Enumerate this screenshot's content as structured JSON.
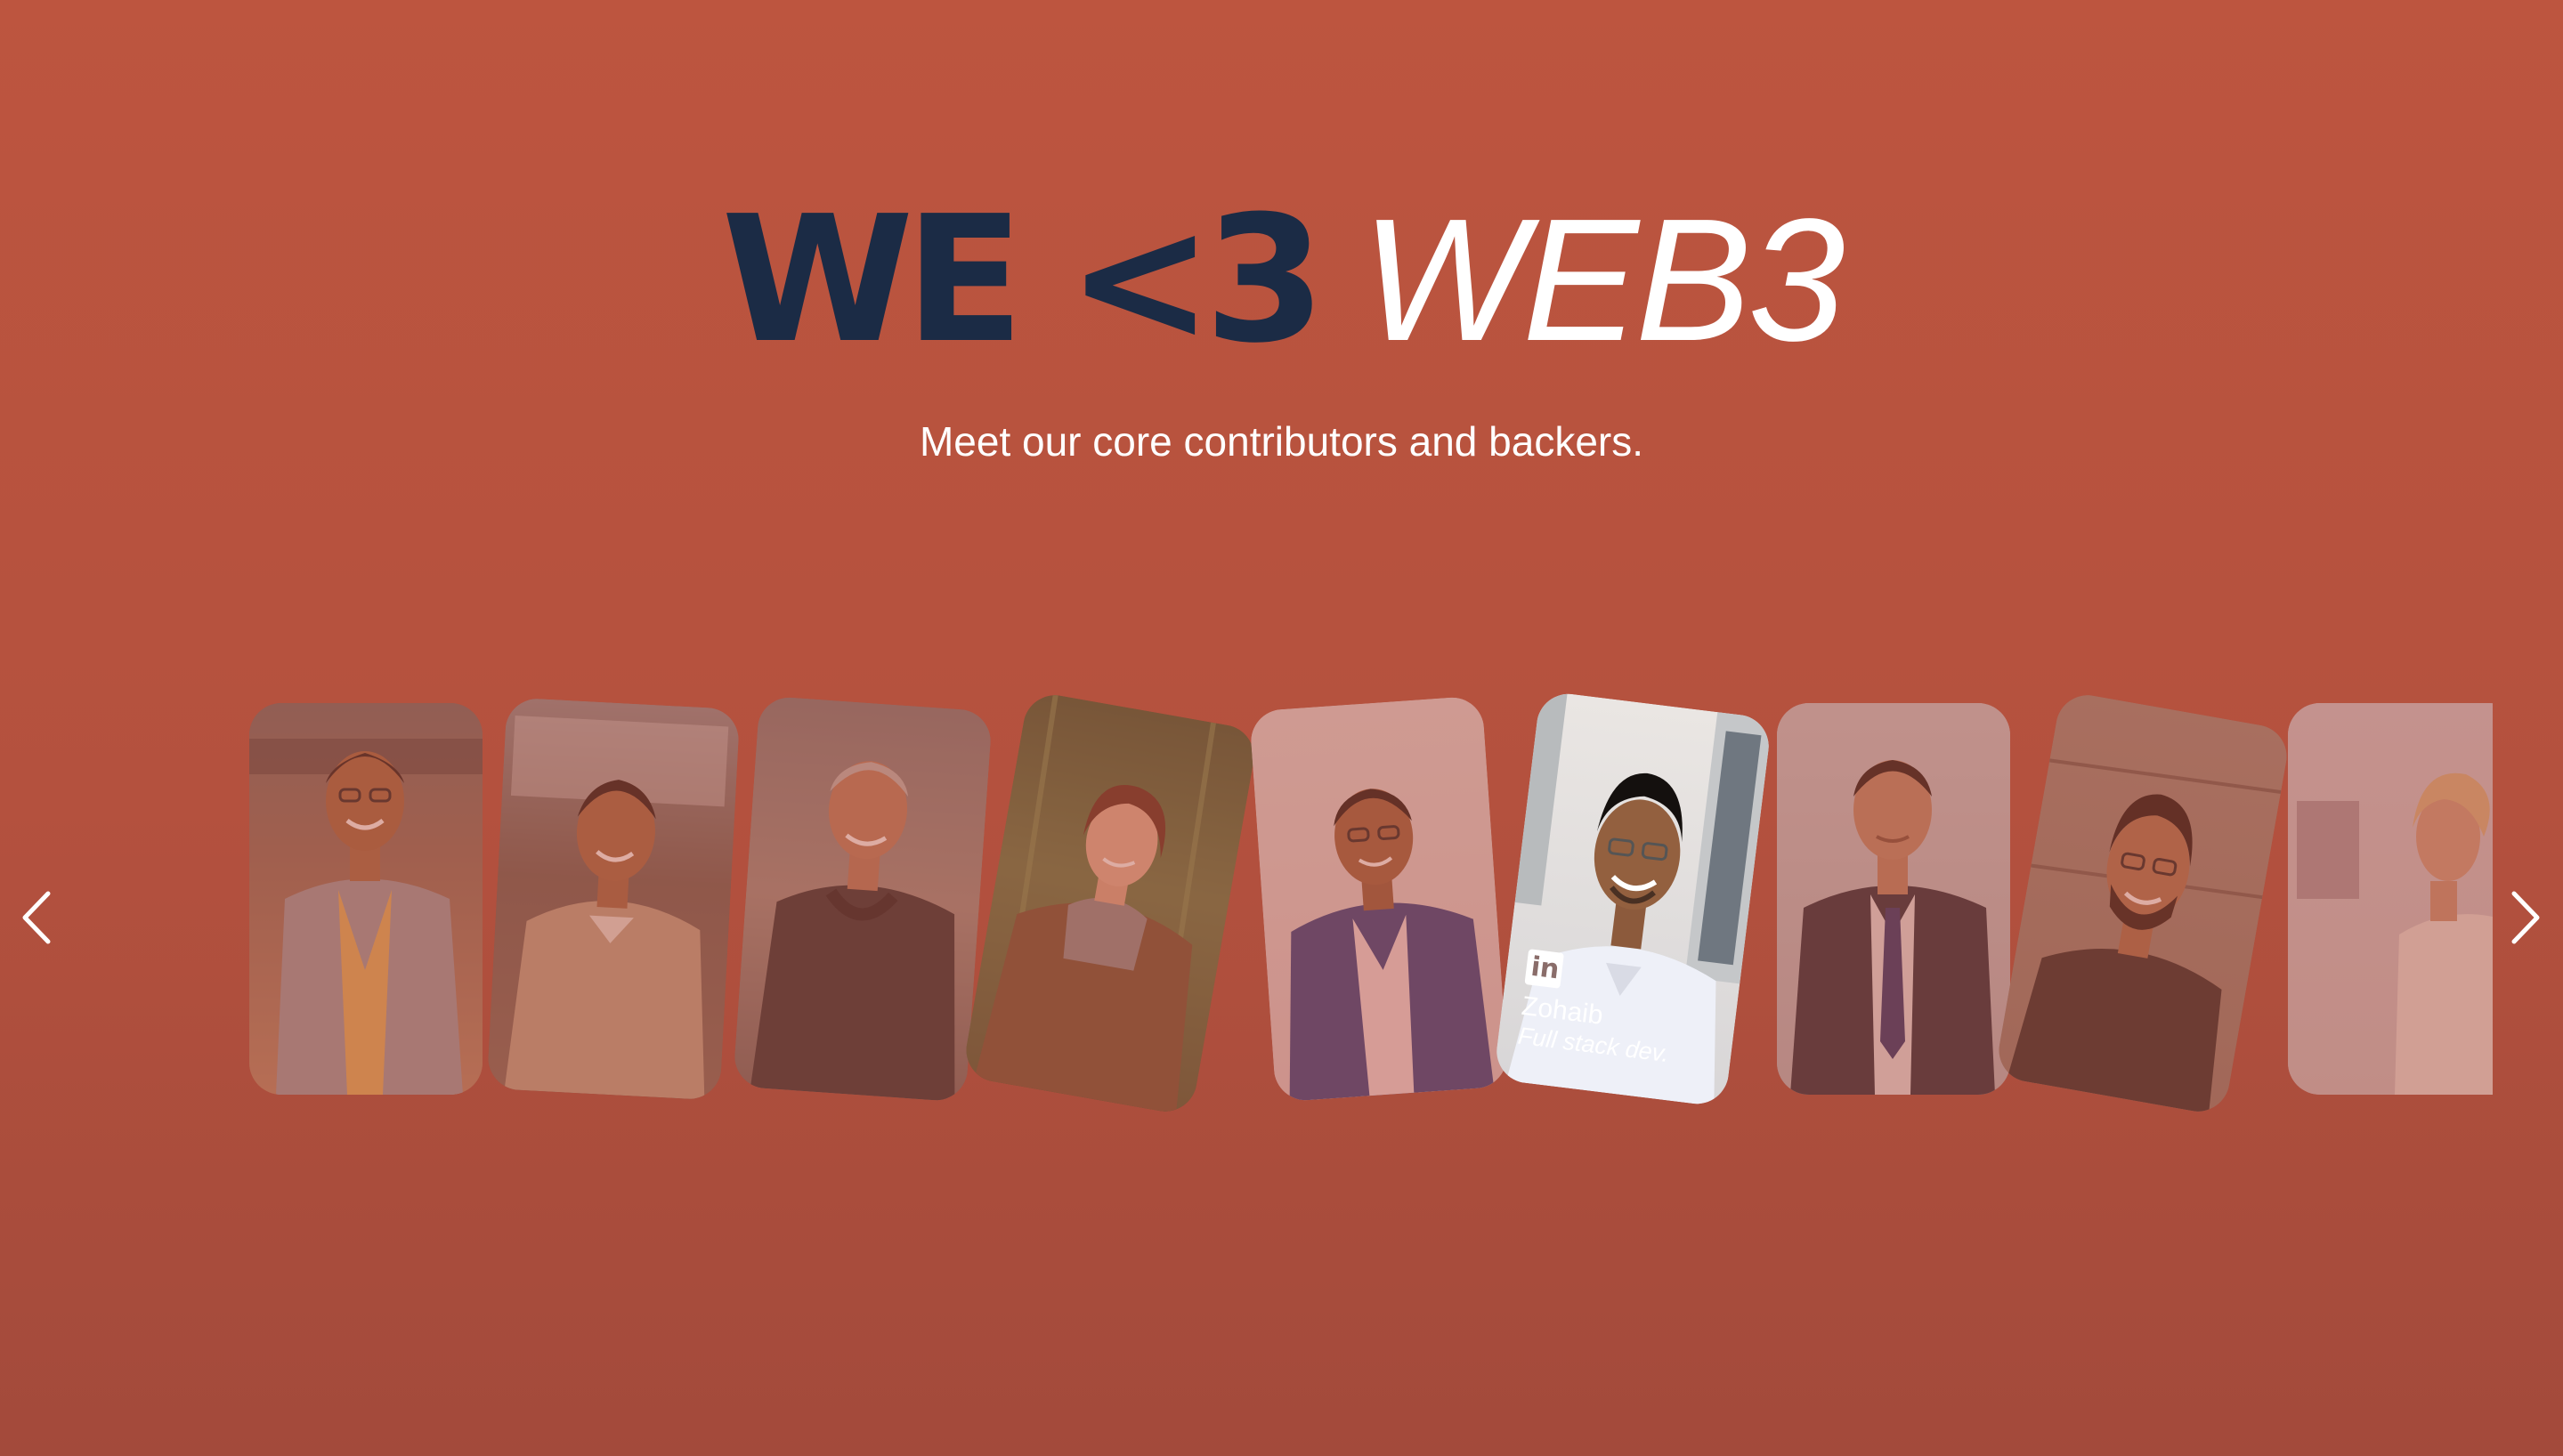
{
  "hero": {
    "headline_bold": "WE <3",
    "headline_light": "WEB3",
    "subtitle": "Meet our core contributors and backers."
  },
  "carousel": {
    "prev_icon": "chevron-left-icon",
    "next_icon": "chevron-right-icon",
    "cards": [
      {
        "name": "",
        "role": "",
        "active": false
      },
      {
        "name": "",
        "role": "",
        "active": false
      },
      {
        "name": "",
        "role": "",
        "active": false
      },
      {
        "name": "",
        "role": "",
        "active": false
      },
      {
        "name": "",
        "role": "",
        "active": false
      },
      {
        "name": "Zohaib",
        "role": "Full stack dev.",
        "active": true,
        "social_icon": "linkedin-icon",
        "social_label": "in"
      },
      {
        "name": "",
        "role": "",
        "active": false
      },
      {
        "name": "",
        "role": "",
        "active": false
      },
      {
        "name": "",
        "role": "",
        "active": false
      }
    ]
  },
  "colors": {
    "background": "#bd553f",
    "headline_dark": "#1b2b45",
    "headline_light": "#ffffff",
    "card_tint": "#b8523e"
  }
}
